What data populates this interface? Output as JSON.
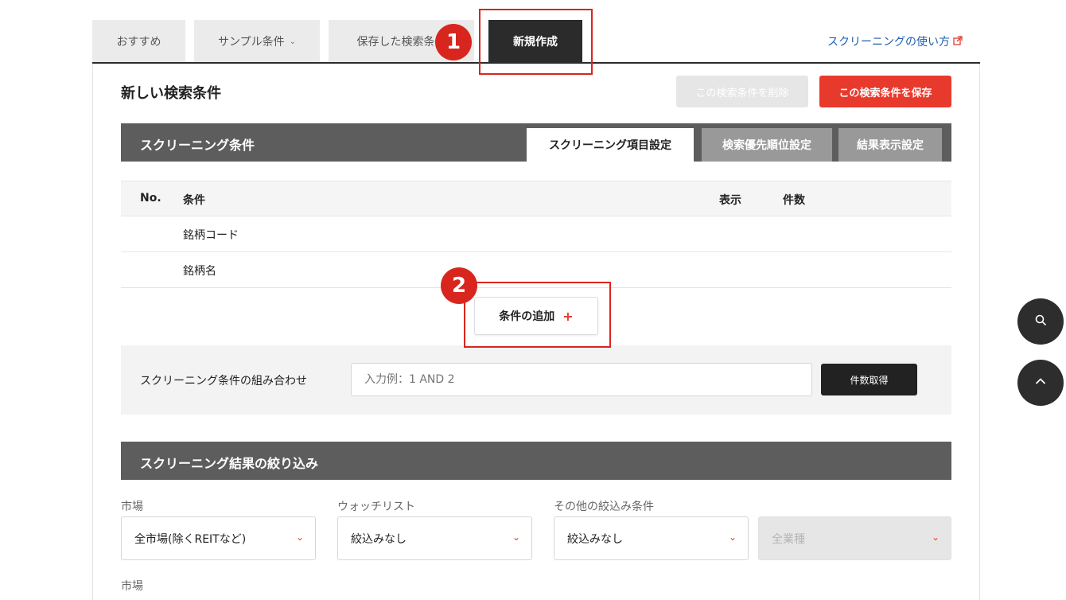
{
  "tabs": [
    {
      "label": "おすすめ"
    },
    {
      "label": "サンプル条件"
    },
    {
      "label": "保存した検索条件"
    },
    {
      "label": "新規作成"
    }
  ],
  "help_link": "スクリーニングの使い方",
  "callouts": [
    "1",
    "2"
  ],
  "page_title": "新しい検索条件",
  "buttons": {
    "delete": "この検索条件を削除",
    "save": "この検索条件を保存",
    "add_condition": "条件の追加",
    "add_plus": "+",
    "count": "件数取得"
  },
  "conditions_section": {
    "title": "スクリーニング条件",
    "subtabs": [
      "スクリーニング項目設定",
      "検索優先順位設定",
      "結果表示設定"
    ]
  },
  "table": {
    "headers": {
      "no": "No.",
      "condition": "条件",
      "display": "表示",
      "count": "件数"
    },
    "rows": [
      "銘柄コード",
      "銘柄名"
    ]
  },
  "combination": {
    "label": "スクリーニング条件の組み合わせ",
    "placeholder": "入力例：1 AND 2"
  },
  "filter_section": {
    "title": "スクリーニング結果の絞り込み",
    "labels": [
      "市場",
      "ウォッチリスト",
      "その他の絞込み条件",
      "市場"
    ],
    "selects": [
      "全市場(除くREITなど)",
      "絞込みなし",
      "絞込みなし",
      "全業種"
    ]
  },
  "icons": {
    "search": "search-icon",
    "scroll_top": "chevron-up-icon",
    "external": "external-link-icon",
    "dropdown": "chevron-down-icon"
  },
  "colors": {
    "accent": "#e8392d",
    "dark": "#2b2b2b",
    "link": "#1f5fae",
    "callout": "#d8261f"
  }
}
